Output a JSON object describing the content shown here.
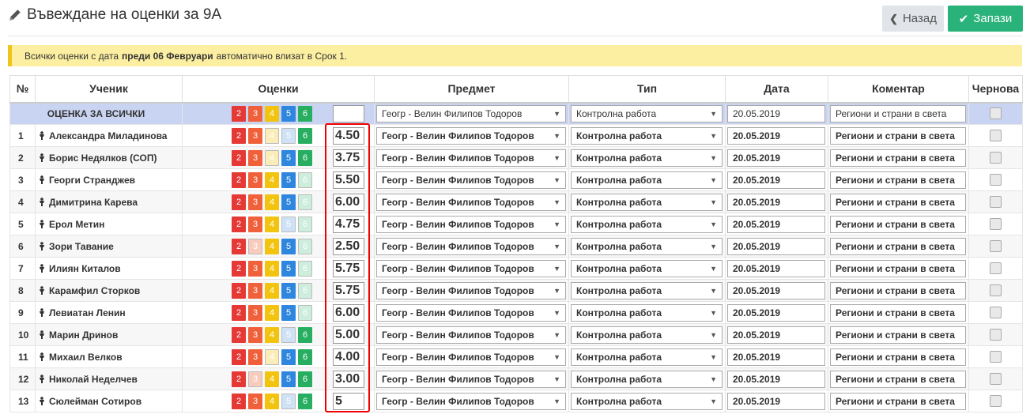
{
  "header": {
    "title": "Въвеждане на оценки за 9А",
    "back_label": "Назад",
    "save_label": "Запази"
  },
  "notice": {
    "prefix": "Всички оценки с дата",
    "bold": "преди 06 Февруари",
    "suffix": "автоматично влизат в Срок 1."
  },
  "table": {
    "headers": [
      "№",
      "Ученик",
      "Оценки",
      "Предмет",
      "Тип",
      "Дата",
      "Коментар",
      "Чернова"
    ],
    "all_row": {
      "label": "ОЦЕНКА ЗА ВСИЧКИ",
      "grade_value": "",
      "subject": "Геогр - Велин Филипов Тодоров",
      "type": "Контролна работа",
      "date": "20.05.2019",
      "comment": "Региони и страни в света"
    },
    "grade_buttons": [
      "2",
      "3",
      "4",
      "5",
      "6"
    ],
    "rows": [
      {
        "num": "1",
        "name": "Александра Миладинова",
        "grade": "4.50",
        "subject": "Геогр - Велин Филипов Тодоров",
        "type": "Контролна работа",
        "date": "20.05.2019",
        "comment": "Региони и страни в света",
        "dim": [
          4,
          5
        ]
      },
      {
        "num": "2",
        "name": "Борис Недялков (СОП)",
        "grade": "3.75",
        "subject": "Геогр - Велин Филипов Тодоров",
        "type": "Контролна работа",
        "date": "20.05.2019",
        "comment": "Региони и страни в света",
        "dim": [
          4
        ]
      },
      {
        "num": "3",
        "name": "Георги Странджев",
        "grade": "5.50",
        "subject": "Геогр - Велин Филипов Тодоров",
        "type": "Контролна работа",
        "date": "20.05.2019",
        "comment": "Региони и страни в света",
        "dim": [
          6
        ]
      },
      {
        "num": "4",
        "name": "Димитрина Карева",
        "grade": "6.00",
        "subject": "Геогр - Велин Филипов Тодоров",
        "type": "Контролна работа",
        "date": "20.05.2019",
        "comment": "Региони и страни в света",
        "dim": [
          6
        ]
      },
      {
        "num": "5",
        "name": "Ерол Метин",
        "grade": "4.75",
        "subject": "Геогр - Велин Филипов Тодоров",
        "type": "Контролна работа",
        "date": "20.05.2019",
        "comment": "Региони и страни в света",
        "dim": [
          5,
          6
        ]
      },
      {
        "num": "6",
        "name": "Зори Тавание",
        "grade": "2.50",
        "subject": "Геогр - Велин Филипов Тодоров",
        "type": "Контролна работа",
        "date": "20.05.2019",
        "comment": "Региони и страни в света",
        "dim": [
          3,
          6
        ]
      },
      {
        "num": "7",
        "name": "Илиян Киталов",
        "grade": "5.75",
        "subject": "Геогр - Велин Филипов Тодоров",
        "type": "Контролна работа",
        "date": "20.05.2019",
        "comment": "Региони и страни в света",
        "dim": [
          6
        ]
      },
      {
        "num": "8",
        "name": "Карамфил Сторков",
        "grade": "5.75",
        "subject": "Геогр - Велин Филипов Тодоров",
        "type": "Контролна работа",
        "date": "20.05.2019",
        "comment": "Региони и страни в света",
        "dim": [
          6
        ]
      },
      {
        "num": "9",
        "name": "Левиатан Ленин",
        "grade": "6.00",
        "subject": "Геогр - Велин Филипов Тодоров",
        "type": "Контролна работа",
        "date": "20.05.2019",
        "comment": "Региони и страни в света",
        "dim": [
          6
        ]
      },
      {
        "num": "10",
        "name": "Марин Дринов",
        "grade": "5.00",
        "subject": "Геогр - Велин Филипов Тодоров",
        "type": "Контролна работа",
        "date": "20.05.2019",
        "comment": "Региони и страни в света",
        "dim": [
          5
        ]
      },
      {
        "num": "11",
        "name": "Михаил Велков",
        "grade": "4.00",
        "subject": "Геогр - Велин Филипов Тодоров",
        "type": "Контролна работа",
        "date": "20.05.2019",
        "comment": "Региони и страни в света",
        "dim": [
          4
        ]
      },
      {
        "num": "12",
        "name": "Николай Неделчев",
        "grade": "3.00",
        "subject": "Геогр - Велин Филипов Тодоров",
        "type": "Контролна работа",
        "date": "20.05.2019",
        "comment": "Региони и страни в света",
        "dim": [
          3
        ]
      },
      {
        "num": "13",
        "name": "Сюлейман Сотиров",
        "grade": "5",
        "subject": "Геогр - Велин Филипов Тодоров",
        "type": "Контролна работа",
        "date": "20.05.2019",
        "comment": "Региони и страни в света",
        "dim": [
          5
        ]
      }
    ]
  },
  "colors": {
    "grade_2": "#e53935",
    "grade_3": "#f0603a",
    "grade_4": "#f2c40f",
    "grade_5": "#2e86de",
    "grade_6": "#27ae60",
    "save_button": "#2ab27b",
    "notice_bg": "#fcefa1",
    "all_row_bg": "#c9d4f2",
    "highlight": "#e00000"
  },
  "icons": {
    "title": "pencil-icon",
    "back": "chevron-left-icon",
    "save": "checkmark-icon",
    "student": "person-icon",
    "select": "caret-down-icon"
  }
}
